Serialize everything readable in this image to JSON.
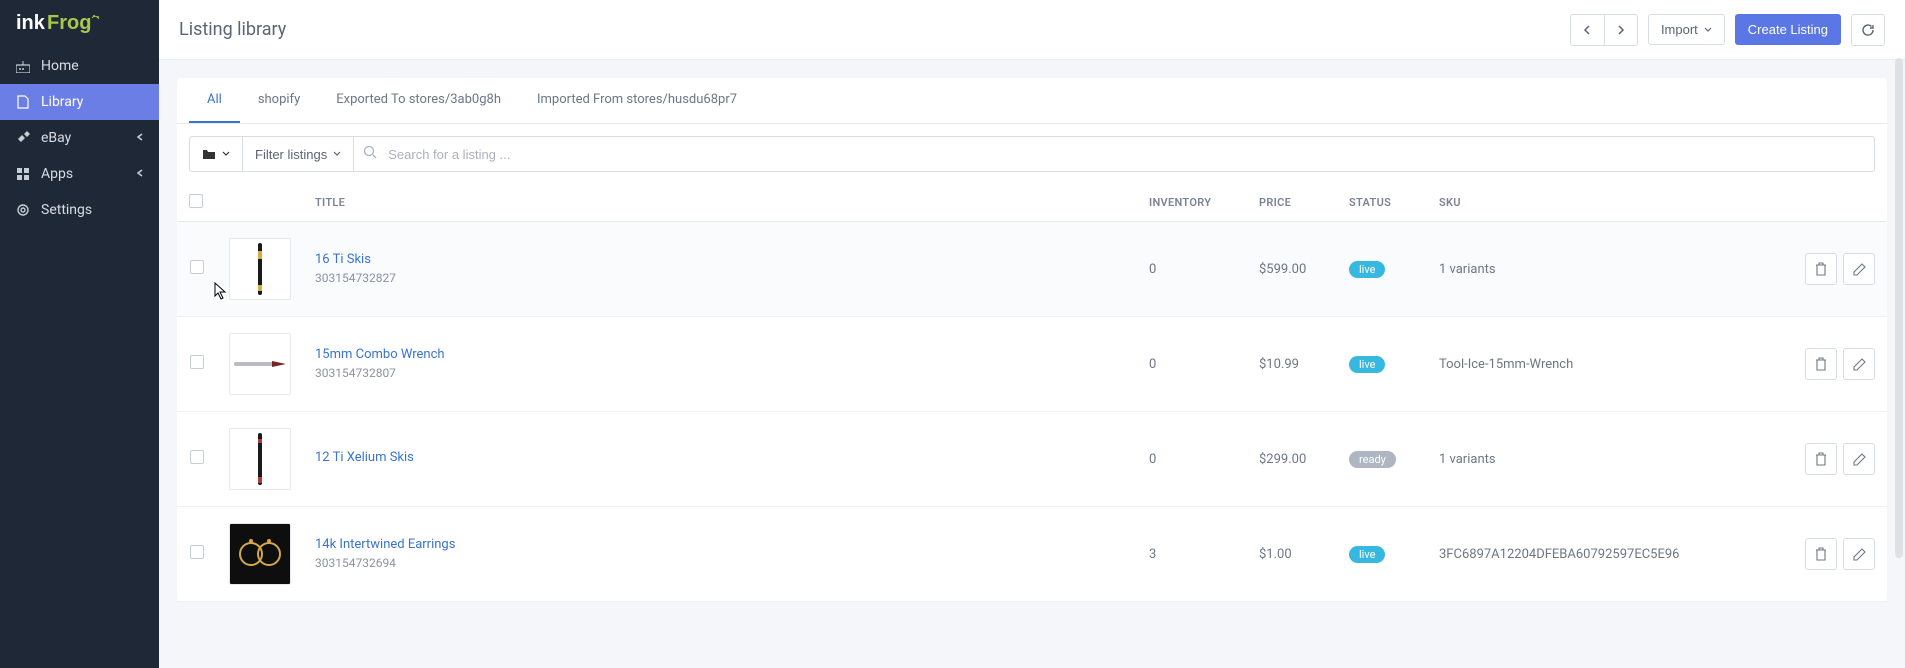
{
  "brand": {
    "name": "inkFrog"
  },
  "sidebar": {
    "items": [
      {
        "label": "Home"
      },
      {
        "label": "Library"
      },
      {
        "label": "eBay"
      },
      {
        "label": "Apps"
      },
      {
        "label": "Settings"
      }
    ]
  },
  "header": {
    "title": "Listing library",
    "import_label": "Import",
    "create_label": "Create Listing"
  },
  "tabs": [
    {
      "label": "All"
    },
    {
      "label": "shopify"
    },
    {
      "label": "Exported To stores/3ab0g8h"
    },
    {
      "label": "Imported From stores/husdu68pr7"
    }
  ],
  "toolbar": {
    "filter_label": "Filter listings",
    "search_placeholder": "Search for a listing ..."
  },
  "columns": {
    "title": "TITLE",
    "inventory": "INVENTORY",
    "price": "PRICE",
    "status": "STATUS",
    "sku": "SKU"
  },
  "rows": [
    {
      "title": "16 Ti Skis",
      "sub": "303154732827",
      "inventory": "0",
      "price": "$599.00",
      "status": "live",
      "sku": "1 variants"
    },
    {
      "title": "15mm Combo Wrench",
      "sub": "303154732807",
      "inventory": "0",
      "price": "$10.99",
      "status": "live",
      "sku": "Tool-Ice-15mm-Wrench"
    },
    {
      "title": "12 Ti Xelium Skis",
      "sub": "",
      "inventory": "0",
      "price": "$299.00",
      "status": "ready",
      "sku": "1 variants"
    },
    {
      "title": "14k Intertwined Earrings",
      "sub": "303154732694",
      "inventory": "3",
      "price": "$1.00",
      "status": "live",
      "sku": "3FC6897A12204DFEBA60792597EC5E96"
    }
  ]
}
